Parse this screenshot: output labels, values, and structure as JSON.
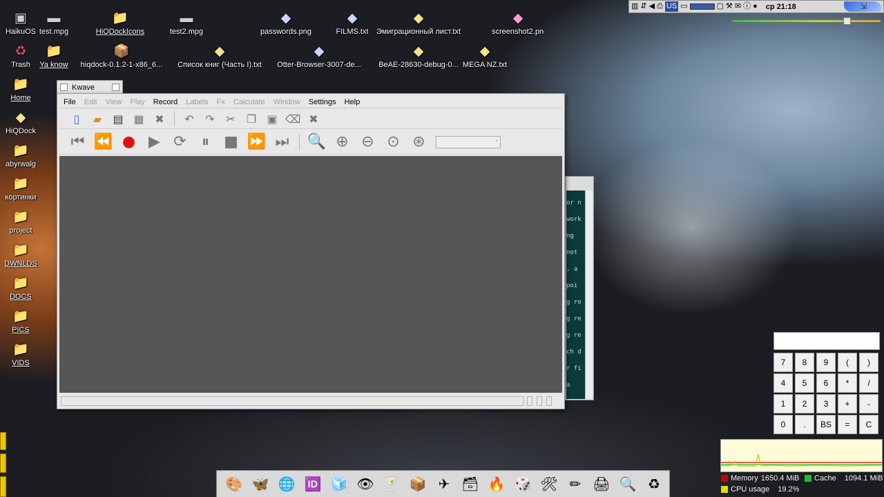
{
  "desktop": {
    "left_icons": [
      {
        "label": "HaikuOS",
        "icon": "disk-icon",
        "glyph": "▣",
        "cls": "g-disk",
        "underline": false
      },
      {
        "label": "Trash",
        "icon": "trash-icon",
        "glyph": "♻",
        "cls": "g-trash",
        "underline": false
      },
      {
        "label": "Home",
        "icon": "folder-icon",
        "glyph": "📁",
        "cls": "g-folder",
        "underline": true
      },
      {
        "label": "HiQDock",
        "icon": "text-file-icon",
        "glyph": "◆",
        "cls": "g-text",
        "underline": false
      },
      {
        "label": "abyrwalg",
        "icon": "folder-icon",
        "glyph": "📁",
        "cls": "g-folder",
        "underline": false
      },
      {
        "label": "кортинки",
        "icon": "folder-icon",
        "glyph": "📁",
        "cls": "g-folder",
        "underline": false
      },
      {
        "label": "project",
        "icon": "folder-icon",
        "glyph": "📁",
        "cls": "g-folder",
        "underline": false
      },
      {
        "label": "DWNLDS",
        "icon": "folder-icon",
        "glyph": "📁",
        "cls": "g-folder",
        "underline": true
      },
      {
        "label": "DOCS",
        "icon": "folder-icon",
        "glyph": "📁",
        "cls": "g-folder",
        "underline": true
      },
      {
        "label": "PICS",
        "icon": "folder-icon",
        "glyph": "📁",
        "cls": "g-folder",
        "underline": true
      },
      {
        "label": "VIDS",
        "icon": "folder-icon",
        "glyph": "📁",
        "cls": "g-folder",
        "underline": true
      }
    ],
    "row1": [
      {
        "label": "test.mpg",
        "icon": "video-file-icon",
        "glyph": "▬",
        "cls": "g-disk",
        "underline": false
      },
      {
        "label": "HiQDockIcons",
        "icon": "folder-icon",
        "glyph": "📁",
        "cls": "g-folder",
        "underline": true
      },
      {
        "label": "test2.mpg",
        "icon": "video-file-icon",
        "glyph": "▬",
        "cls": "g-disk",
        "underline": false
      },
      {
        "label": "passwords.png",
        "icon": "image-file-icon",
        "glyph": "◆",
        "cls": "g-image",
        "underline": false
      },
      {
        "label": "FILMS.txt",
        "icon": "image-file-icon",
        "glyph": "◆",
        "cls": "g-image",
        "underline": false
      },
      {
        "label": "Эмиграционный лист.txt",
        "icon": "text-file-icon",
        "glyph": "◆",
        "cls": "g-text",
        "underline": false
      },
      {
        "label": "screenshot2.png",
        "icon": "image-file-icon",
        "glyph": "◆",
        "cls": "g-pink",
        "underline": false
      }
    ],
    "row2": [
      {
        "label": "Ya know",
        "icon": "folder-icon",
        "glyph": "📁",
        "cls": "g-folder",
        "underline": true
      },
      {
        "label": "hiqdock-0.1.2-1-x86_6...",
        "icon": "package-icon",
        "glyph": "📦",
        "cls": "g-folder",
        "underline": false
      },
      {
        "label": "Список книг (Часть I).txt",
        "icon": "text-file-icon",
        "glyph": "◆",
        "cls": "g-text",
        "underline": false
      },
      {
        "label": "Otter-Browser-3007-de...",
        "icon": "image-file-icon",
        "glyph": "◆",
        "cls": "g-image",
        "underline": false
      },
      {
        "label": "BeAE-28630-debug-0...",
        "icon": "text-file-icon",
        "glyph": "◆",
        "cls": "g-text",
        "underline": false
      },
      {
        "label": "MEGA NZ.txt",
        "icon": "text-file-icon",
        "glyph": "◆",
        "cls": "g-text",
        "underline": false
      }
    ]
  },
  "deskbar": {
    "keymap": "US",
    "clock": "ср 21:18"
  },
  "kwave": {
    "title": "Kwave",
    "menu": [
      {
        "label": "File",
        "enabled": true
      },
      {
        "label": "Edit",
        "enabled": false
      },
      {
        "label": "View",
        "enabled": false
      },
      {
        "label": "Play",
        "enabled": false
      },
      {
        "label": "Record",
        "enabled": true
      },
      {
        "label": "Labels",
        "enabled": false
      },
      {
        "label": "Fx",
        "enabled": false
      },
      {
        "label": "Calculate",
        "enabled": false
      },
      {
        "label": "Window",
        "enabled": false
      },
      {
        "label": "Settings",
        "enabled": true
      },
      {
        "label": "Help",
        "enabled": true
      }
    ]
  },
  "terminal": {
    "lines": [
      "or n",
      "work",
      "ng",
      "not",
      ", a",
      "poi",
      "g re",
      "g re",
      "g re",
      "ch d",
      "r fi",
      "a"
    ]
  },
  "calculator": {
    "display": "",
    "keys": [
      "7",
      "8",
      "9",
      "(",
      ")",
      "4",
      "5",
      "6",
      "*",
      "/",
      "1",
      "2",
      "3",
      "+",
      "-",
      "0",
      ".",
      "BS",
      "=",
      "C"
    ]
  },
  "monitor": {
    "memory_label": "Memory",
    "memory_value": "1650.4 MiB",
    "cache_label": "Cache",
    "cache_value": "1094.1 MiB",
    "cpu_label": "CPU usage",
    "cpu_value": "19.2%",
    "colors": {
      "memory": "#cc0000",
      "cache": "#22bb22",
      "cpu": "#dddd00"
    }
  },
  "dock": {
    "items": [
      {
        "icon": "paint-icon",
        "glyph": "🎨"
      },
      {
        "icon": "butterfly-icon",
        "glyph": "🦋"
      },
      {
        "icon": "globe-icon",
        "glyph": "🌐"
      },
      {
        "icon": "id-badge-icon",
        "glyph": "🆔"
      },
      {
        "icon": "box-icon",
        "glyph": "🧊"
      },
      {
        "icon": "eye-icon",
        "glyph": "👁"
      },
      {
        "icon": "cocktail-icon",
        "glyph": "🍸"
      },
      {
        "icon": "installer-icon",
        "glyph": "📦"
      },
      {
        "icon": "plane-icon",
        "glyph": "✈"
      },
      {
        "icon": "archive-icon",
        "glyph": "🗃"
      },
      {
        "icon": "fire-icon",
        "glyph": "🔥"
      },
      {
        "icon": "cube-icon",
        "glyph": "🎲"
      },
      {
        "icon": "tools-icon",
        "glyph": "🛠"
      },
      {
        "icon": "pencil-icon",
        "glyph": "✏"
      },
      {
        "icon": "printer-icon",
        "glyph": "🖨"
      },
      {
        "icon": "magnifier-icon",
        "glyph": "🔍"
      },
      {
        "icon": "trash-dock-icon",
        "glyph": "♻"
      }
    ]
  }
}
